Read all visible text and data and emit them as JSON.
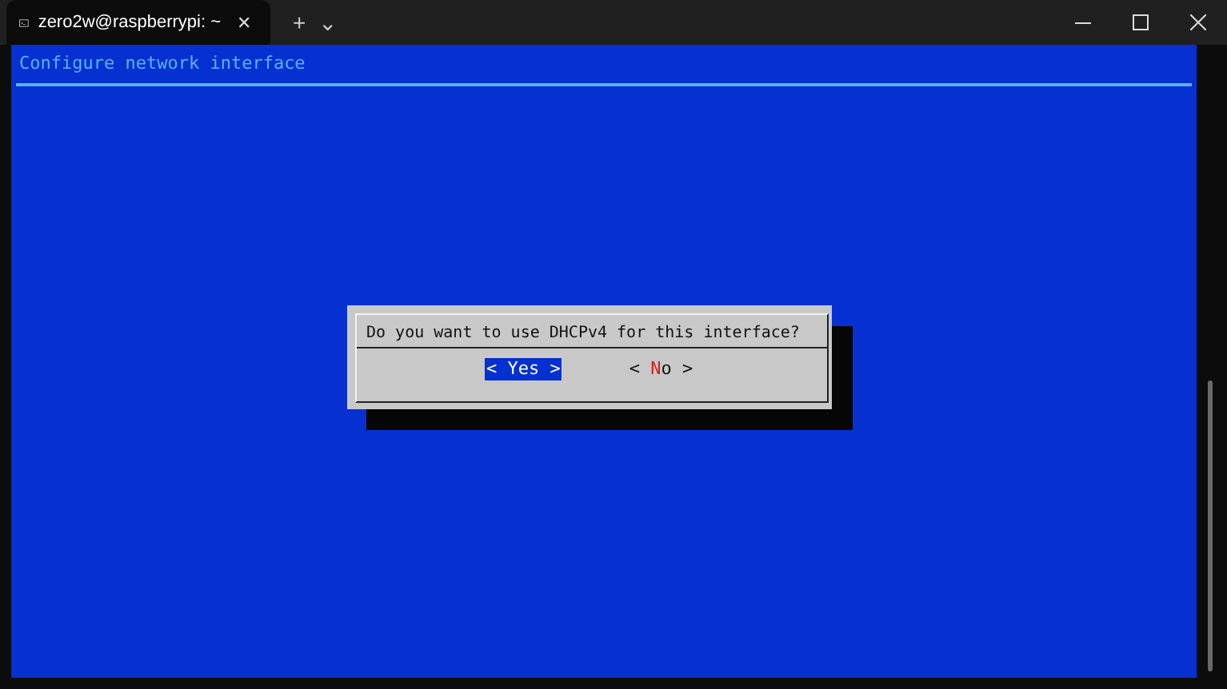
{
  "window": {
    "tab_title": "zero2w@raspberrypi: ~",
    "tab_close": "✕",
    "new_tab": "+",
    "tab_menu": "⌄"
  },
  "screen": {
    "title": "Configure network interface"
  },
  "dialog": {
    "message": "Do you want to use DHCPv4 for this interface?",
    "buttons": [
      {
        "left": "<",
        "hotkey": "Y",
        "rest": "es",
        "right": ">",
        "selected": true
      },
      {
        "left": "<",
        "hotkey": "N",
        "rest": "o",
        "right": ">",
        "selected": false
      }
    ]
  }
}
